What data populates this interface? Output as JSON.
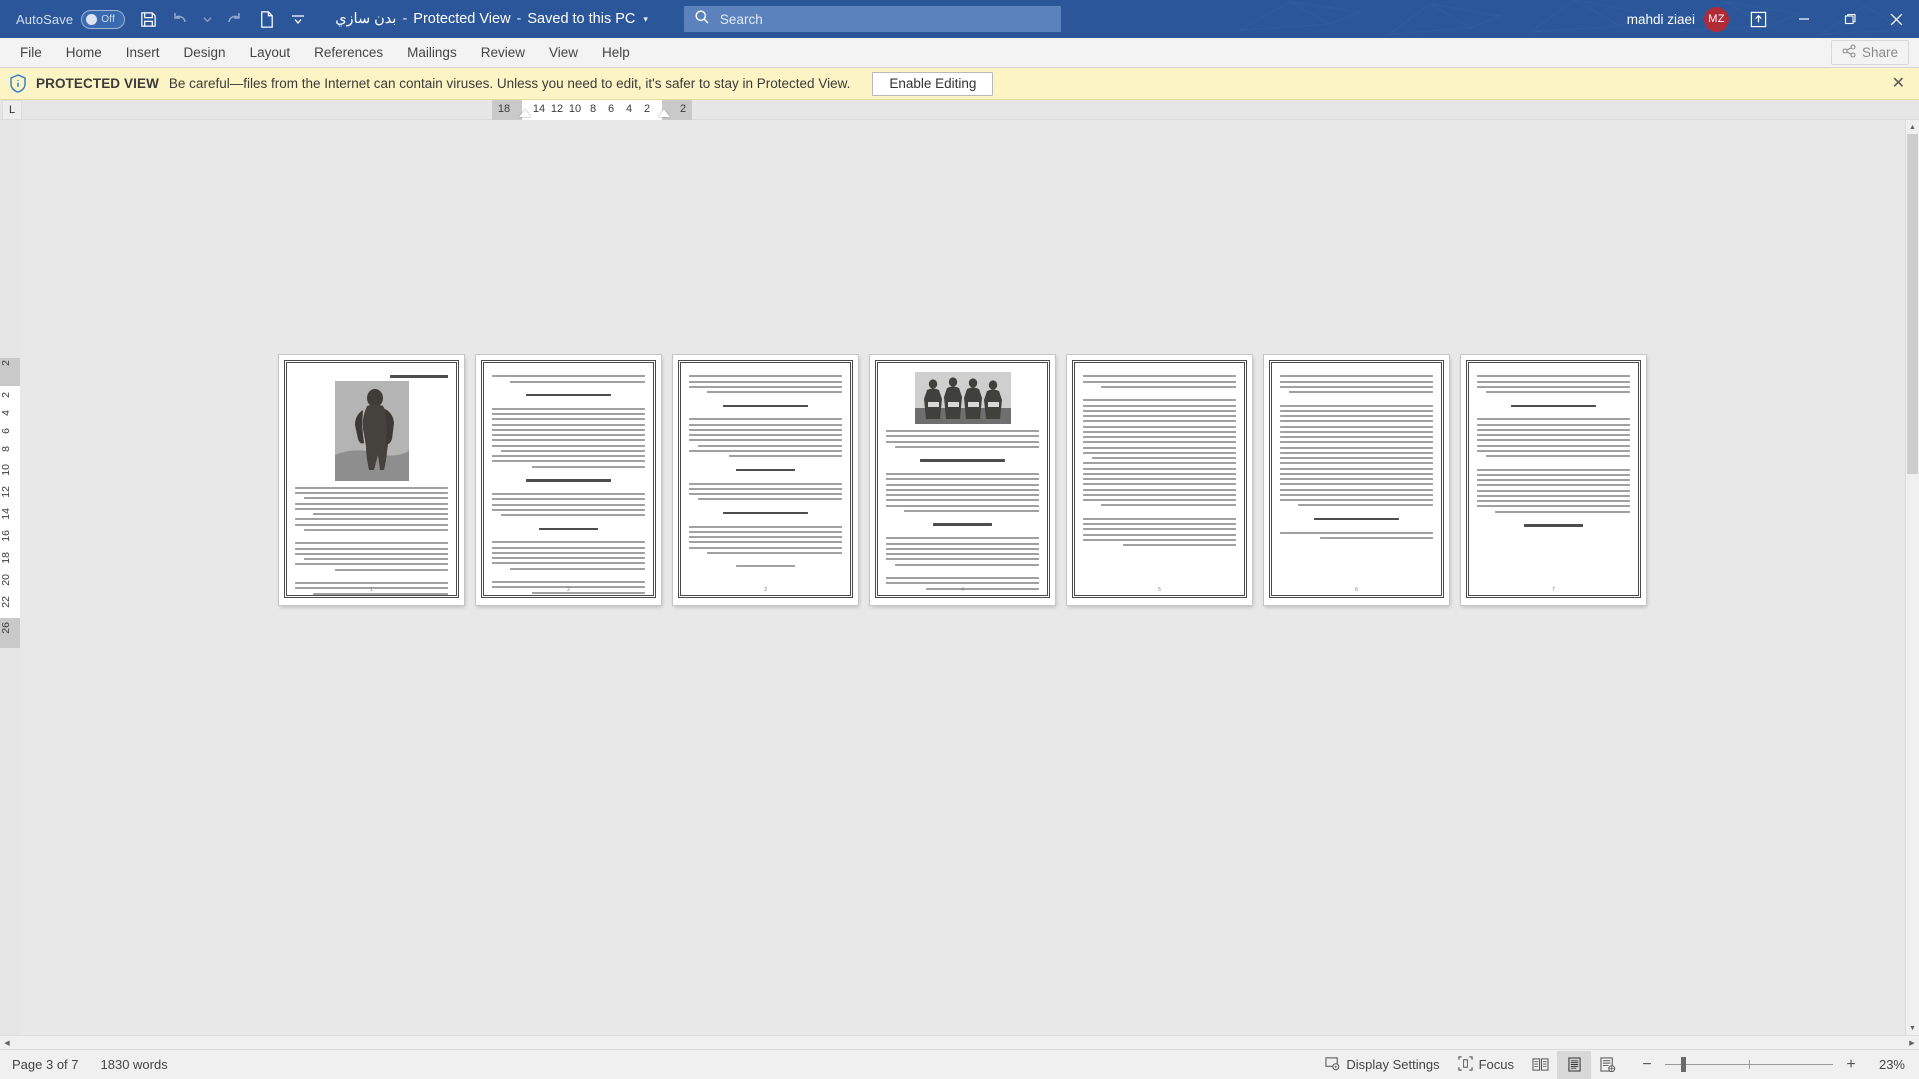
{
  "titlebar": {
    "autosave_label": "AutoSave",
    "autosave_state": "Off",
    "save_icon": "save-icon",
    "undo_icon": "undo-icon",
    "redo_icon": "redo-icon",
    "new_icon": "new-document-icon",
    "customize_icon": "customize-quick-access-toolbar-icon",
    "document_name": "بدن سازي",
    "separator": "-",
    "protected_view_label": "Protected View",
    "save_location": "Saved to this PC",
    "location_caret": "▾",
    "search_placeholder": "Search",
    "search_value": "",
    "search_icon": "search-icon",
    "account_name": "mahdi ziaei",
    "account_initials": "MZ",
    "ribbon_display_icon": "ribbon-display-options-icon",
    "minimize_label": "Minimize",
    "restore_label": "Restore Down",
    "close_label": "Close",
    "accent_color": "#2b579a",
    "avatar_color": "#b02a37"
  },
  "ribbon": {
    "tabs": [
      {
        "label": "File"
      },
      {
        "label": "Home"
      },
      {
        "label": "Insert"
      },
      {
        "label": "Design"
      },
      {
        "label": "Layout"
      },
      {
        "label": "References"
      },
      {
        "label": "Mailings"
      },
      {
        "label": "Review"
      },
      {
        "label": "View"
      },
      {
        "label": "Help"
      }
    ],
    "share_label": "Share",
    "share_icon": "share-icon"
  },
  "protected_view": {
    "icon": "info-shield-icon",
    "title": "PROTECTED VIEW",
    "message": "Be careful—files from the Internet can contain viruses. Unless you need to edit, it's safer to stay in Protected View.",
    "button_label": "Enable Editing",
    "close_label": "✕",
    "background_color": "#fcf4c4"
  },
  "rulers": {
    "tab_stop_marker": "L",
    "horizontal_numbers": [
      "18",
      "14",
      "12",
      "10",
      "8",
      "6",
      "4",
      "2",
      "2"
    ],
    "vertical_numbers": [
      "2",
      "2",
      "4",
      "6",
      "8",
      "10",
      "12",
      "14",
      "16",
      "18",
      "20",
      "22",
      "26"
    ]
  },
  "document": {
    "zoom_view": "multiple-pages",
    "pages": [
      {
        "index": 1,
        "footer_number": "1",
        "has_photo": true,
        "photo_name": "bodybuilder-photo",
        "heading": "بدن سازي",
        "body_preview": "بدنسازی (به انگلیسی: Bodybuilding) به انجام یکسری تمرینات بدنی با وسیله و بدون وسیله گفته می‌شود"
      },
      {
        "index": 2,
        "footer_number": "2",
        "has_photo": false,
        "heading": "مواد معدني",
        "body_preview": "تاریخچه بدنسازی در جهان غرب - تاریخ پرورش اندام"
      },
      {
        "index": 3,
        "footer_number": "3",
        "has_photo": false,
        "heading": "مواد مغذي",
        "body_preview": "کار کرد ورزش برای سلامتی بدن"
      },
      {
        "index": 4,
        "footer_number": "4",
        "has_photo": true,
        "photo_name": "bodybuilders-group-photo",
        "heading": "شيوه انجام حركت",
        "body_preview": "مسابقات در این رشته در کلاس های مختلفی برگزار می‌شود"
      },
      {
        "index": 5,
        "footer_number": "5",
        "has_photo": false,
        "heading": "سينه با دمبل",
        "body_preview": "عضلات هر كدام از اين وزنه‌ها ظرفيت محدودي دارند"
      },
      {
        "index": 6,
        "footer_number": "6",
        "has_photo": false,
        "heading": "شيوه تغذيه",
        "body_preview": "پاور ليفتينگ يك ورزش قدرتي است"
      },
      {
        "index": 7,
        "footer_number": "7",
        "has_photo": false,
        "heading": "نتيجه گيري",
        "body_preview": "استراحت هاي مهمي از بدنسازي محسوب مي‌شود"
      }
    ]
  },
  "statusbar": {
    "page_indicator": "Page 3 of 7",
    "word_count": "1830 words",
    "display_settings_label": "Display Settings",
    "display_settings_icon": "display-settings-icon",
    "focus_label": "Focus",
    "focus_icon": "focus-mode-icon",
    "view_read_icon": "read-mode-icon",
    "view_print_icon": "print-layout-icon",
    "view_web_icon": "web-layout-icon",
    "active_view": "print-layout",
    "zoom_out_label": "−",
    "zoom_in_label": "+",
    "zoom_level": "23%"
  }
}
